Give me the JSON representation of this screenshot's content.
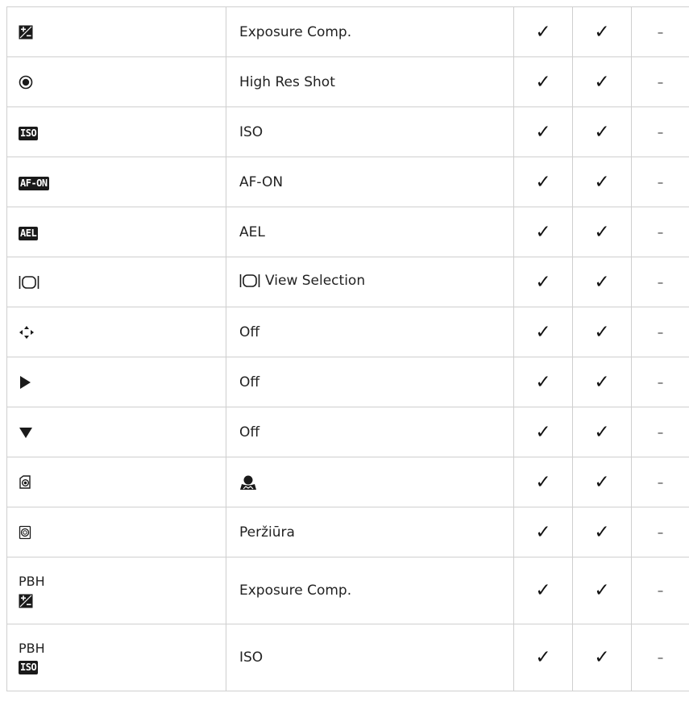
{
  "rows": [
    {
      "control_icon": "exposure-comp-icon",
      "function": "Exposure Comp.",
      "col3": "✓",
      "col4": "✓",
      "col5": "–"
    },
    {
      "control_icon": "high-res-shot-icon",
      "function": "High Res Shot",
      "col3": "✓",
      "col4": "✓",
      "col5": "–"
    },
    {
      "control_icon": "iso-icon",
      "icon_text": "ISO",
      "function": "ISO",
      "col3": "✓",
      "col4": "✓",
      "col5": "–"
    },
    {
      "control_icon": "af-on-icon",
      "icon_text": "AF-ON",
      "function": "AF-ON",
      "col3": "✓",
      "col4": "✓",
      "col5": "–"
    },
    {
      "control_icon": "ael-icon",
      "icon_text": "AEL",
      "function": "AEL",
      "col3": "✓",
      "col4": "✓",
      "col5": "–"
    },
    {
      "control_icon": "view-selection-icon",
      "function": "View Selection",
      "col3": "✓",
      "col4": "✓",
      "col5": "–"
    },
    {
      "control_icon": "arrow-pad-icon",
      "function": "Off",
      "col3": "✓",
      "col4": "✓",
      "col5": "–"
    },
    {
      "control_icon": "right-triangle-icon",
      "function": "Off",
      "col3": "✓",
      "col4": "✓",
      "col5": "–"
    },
    {
      "control_icon": "down-triangle-icon",
      "function": "Off",
      "col3": "✓",
      "col4": "✓",
      "col5": "–"
    },
    {
      "control_icon": "lens-fn-button-icon",
      "function_icon": "person-icon",
      "col3": "✓",
      "col4": "✓",
      "col5": "–"
    },
    {
      "control_icon": "preview-button-icon",
      "function": "Peržiūra",
      "col3": "✓",
      "col4": "✓",
      "col5": "–"
    },
    {
      "pbh_label": "PBH",
      "control_icon": "exposure-comp-icon",
      "function": "Exposure Comp.",
      "col3": "✓",
      "col4": "✓",
      "col5": "–"
    },
    {
      "pbh_label": "PBH",
      "control_icon": "iso-icon",
      "icon_text": "ISO",
      "function": "ISO",
      "col3": "✓",
      "col4": "✓",
      "col5": "–"
    }
  ]
}
